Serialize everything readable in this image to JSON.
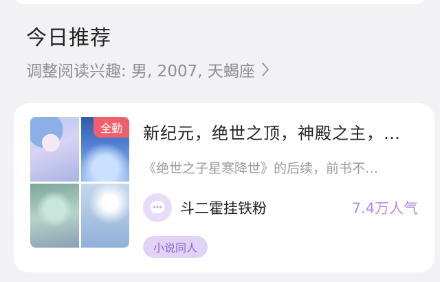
{
  "section": {
    "title": "今日推荐",
    "interest_text": "调整阅读兴趣: 男, 2007, 天蝎座"
  },
  "book": {
    "badge": "全勤",
    "title": "新纪元，绝世之顶，神殿之主，…",
    "description": "《绝世之子星寒降世》的后续，前书不…",
    "author": "斗二霍挂铁粉",
    "popularity": "7.4万人气",
    "tag": "小说同人"
  },
  "icons": {
    "interest_arrow": "chevron-right-icon",
    "author_avatar": "chat-bubble-icon"
  },
  "colors": {
    "badge": "#f0606c",
    "accent": "#b18be6",
    "tag_bg": "#e2d3f6"
  }
}
